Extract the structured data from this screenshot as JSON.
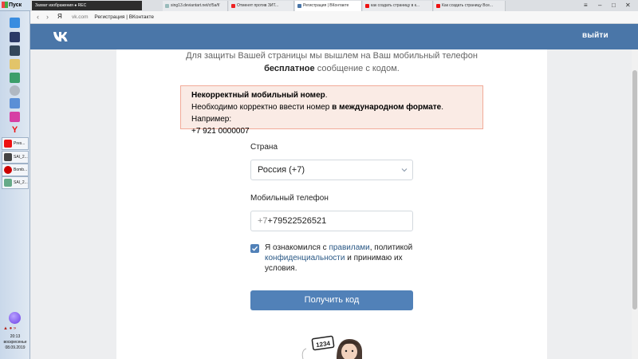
{
  "taskbar": {
    "start_label": "Пуск",
    "tasks": [
      "Pres...",
      "SAI_2...",
      "Bomb...",
      "SAI_2..."
    ],
    "clock": {
      "time": "20:13",
      "day": "воскресенье",
      "date": "08.09.2019"
    }
  },
  "browser": {
    "recorder_strip": "Захват изображения  ● REC",
    "tabs": [
      {
        "label": "sing13.deviantart.net/cf5a/f/"
      },
      {
        "label": "Отменят против ЗИТ..."
      },
      {
        "label": "Регистрация | ВКонтакте",
        "active": true
      },
      {
        "label": "как создать страницу в к..."
      },
      {
        "label": "Как создать страницу Все..."
      }
    ],
    "address": {
      "host": "vk.com",
      "title": "Регистрация | ВКонтакте"
    },
    "yandex_glyph": "Я"
  },
  "header": {
    "logout_label": "выйти",
    "brand_color": "#4a76a8"
  },
  "main": {
    "intro_part1": "Для защиты Вашей страницы мы вышлем на Ваш мобильный телефон",
    "intro_bold": "бесплатное",
    "intro_part2": "сообщение с кодом.",
    "error": {
      "title": "Некорректный мобильный номер",
      "line_part1": "Необходимо корректно ввести номер",
      "line_bold": "в международном формате",
      "line_part2": ". Например:",
      "example": "+7 921 0000007"
    },
    "country_label": "Страна",
    "country_value": "Россия (+7)",
    "phone_label": "Мобильный телефон",
    "phone_prefix": "+7",
    "phone_value": "+79522526521",
    "agree_part1": "Я ознакомился с",
    "agree_link1": "правилами",
    "agree_part2": ", политикой",
    "agree_link2": "конфиденциальности",
    "agree_part3": "и принимаю их условия.",
    "agree_checked": true,
    "submit_label": "Получить код",
    "mascot_sign": "1234"
  }
}
